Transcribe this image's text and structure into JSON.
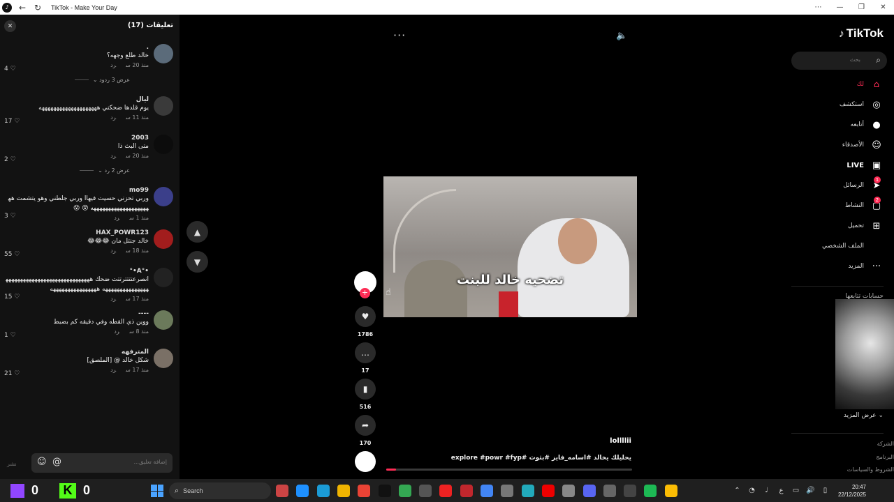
{
  "window": {
    "title": "TikTok - Make Your Day",
    "controls": [
      "⋯",
      "—",
      "❐",
      "✕"
    ]
  },
  "comments": {
    "title": "تعليقات (17)",
    "close": "✕",
    "items": [
      {
        "user": ".",
        "text": "خالد طلع وجهه؟",
        "time": "منذ 20 س",
        "reply": "رد",
        "likes": "4",
        "more": "عرض 3 ردود"
      },
      {
        "user": "ليال",
        "text": "يوم قلدها ضحكني ههههههههههههههههههههه",
        "time": "منذ 11 س",
        "reply": "رد",
        "likes": "17",
        "more": ""
      },
      {
        "user": "2003",
        "text": "متى البث ذا",
        "time": "منذ 20 س",
        "reply": "رد",
        "likes": "2",
        "more": "عرض 2 رد"
      },
      {
        "user": "mo99",
        "text": "وربي تحزني حسيت فيهاا وربي جلطني وهو يتشمت هههههههههههههههههههههه 😵 😵",
        "time": "منذ 1 س",
        "reply": "رد",
        "likes": "3",
        "more": ""
      },
      {
        "user": "HAX_POWR123",
        "text": "خالد جنتل مان 😂😂😂",
        "time": "منذ 18 س",
        "reply": "رد",
        "likes": "55",
        "more": ""
      },
      {
        "user": "•°A•°",
        "text": "انصرعتتتترتتت ضحك هههههههههههههههههههههههههههههههههههههههههههههه ههههههههههههههههه",
        "time": "منذ 17 س",
        "reply": "رد",
        "likes": "15",
        "more": ""
      },
      {
        "user": "----",
        "text": "ووين ذي القطه وفي دقيقه كم بضبط",
        "time": "منذ 8 س",
        "reply": "رد",
        "likes": "1",
        "more": ""
      },
      {
        "user": "المترفهه",
        "text": "شكل خالد @ [الملصق]",
        "time": "منذ 17 س",
        "reply": "رد",
        "likes": "21",
        "more": ""
      }
    ],
    "input_placeholder": "إضافة تعليق...",
    "post_label": "نشر",
    "emoji_icon": "☺",
    "mention_icon": "@"
  },
  "video": {
    "caption": "تضحيه خالد للبنت",
    "author": "lollllii",
    "description": "يحليلك يخالد #اسامه_فايز #بثوث #explore #powr #fyp",
    "likes": "1786",
    "comments": "17",
    "saves": "516",
    "shares": "170",
    "more_dots": "···",
    "progress_pct": 4
  },
  "sidebar": {
    "topline": "· · ·   · · ·",
    "logo": "TikTok",
    "search_placeholder": "بحث",
    "nav": [
      {
        "label": "لك",
        "icon": "⌂",
        "badge": ""
      },
      {
        "label": "استكشف",
        "icon": "◎",
        "badge": ""
      },
      {
        "label": "أتابعه",
        "icon": "●",
        "badge": ""
      },
      {
        "label": "الأصدقاء",
        "icon": "☺",
        "badge": ""
      },
      {
        "label": "LIVE",
        "icon": "▣",
        "badge": ""
      },
      {
        "label": "الرسائل",
        "icon": "➤",
        "badge": "1"
      },
      {
        "label": "النشاط",
        "icon": "▢",
        "badge": "2"
      },
      {
        "label": "تحميل",
        "icon": "⊞",
        "badge": ""
      },
      {
        "label": "الملف الشخصي",
        "icon": "",
        "badge": ""
      },
      {
        "label": "المزيد",
        "icon": "···",
        "badge": ""
      }
    ],
    "following_title": "حسابات تتابعها",
    "show_more": "عرض المزيد",
    "footer": [
      "الشركة",
      "البرنامج",
      "الشروط والسياسات"
    ]
  },
  "taskbar": {
    "twitch_count": "0",
    "kick_count": "0",
    "kick_letter": "K",
    "search_label": "Search",
    "time": "20:47",
    "date": "22/12/2025",
    "lang": "ع",
    "apps": [
      "#c44",
      "#1e90ff",
      "#1b9bd6",
      "#f0b400",
      "#ea4335",
      "#111",
      "#34a853",
      "#555",
      "#e22",
      "#c1272d",
      "#4285f4",
      "#777",
      "#2ab",
      "#e00",
      "#888",
      "#5865f2",
      "#666",
      "#444",
      "#1db954",
      "#fbbc04"
    ]
  },
  "colors": {
    "accent": "#fe2c55",
    "background": "#000000",
    "panel": "#121212"
  }
}
